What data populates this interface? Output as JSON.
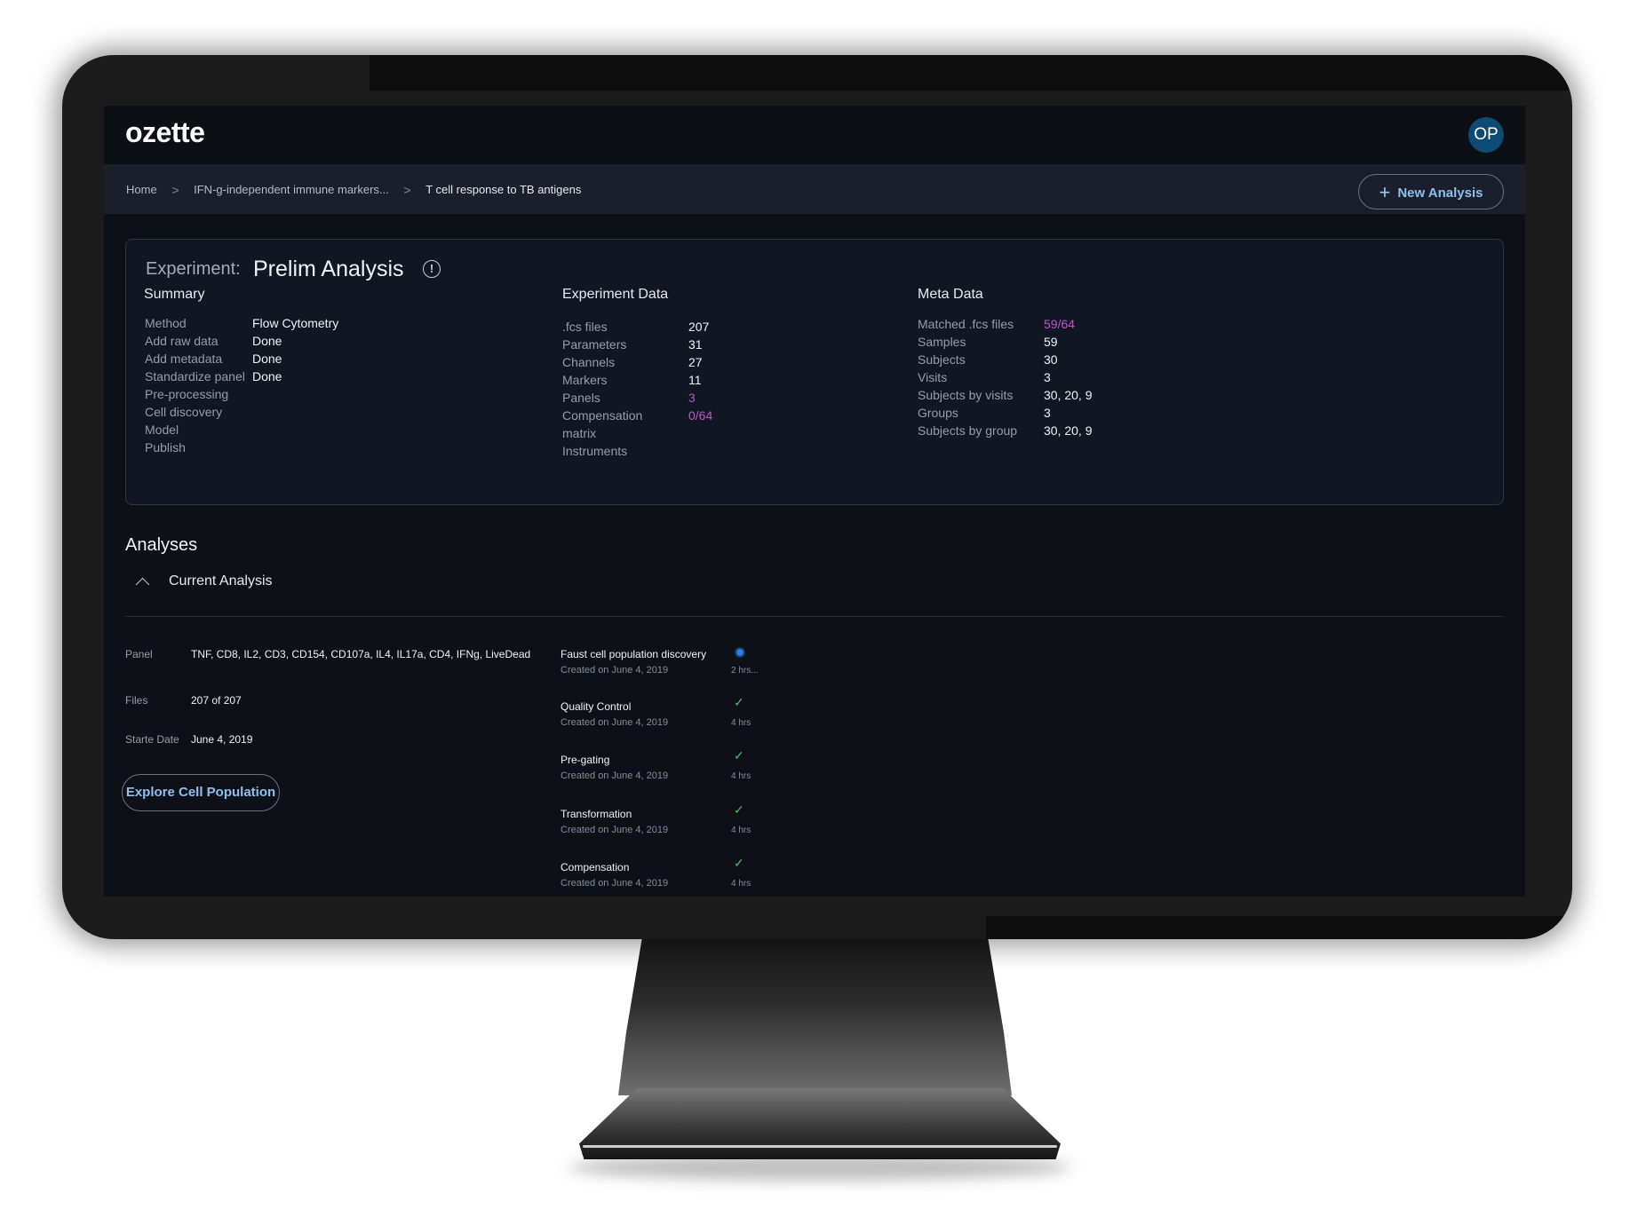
{
  "app": {
    "logo": "ozette",
    "avatar_initials": "OP"
  },
  "breadcrumb": {
    "items": [
      "Home",
      "IFN-g-independent immune markers...",
      "T cell response to TB antigens"
    ],
    "separator": ">"
  },
  "header": {
    "new_analysis_label": "New Analysis",
    "plus_icon": "+"
  },
  "experiment": {
    "label": "Experiment:",
    "title": "Prelim Analysis",
    "info_icon": "!",
    "summary": {
      "heading": "Summary",
      "rows": [
        {
          "key": "Method",
          "value": "Flow Cytometry"
        },
        {
          "key": "Add raw data",
          "value": "Done"
        },
        {
          "key": "Add metadata",
          "value": "Done"
        },
        {
          "key": "Standardize panel",
          "value": "Done"
        },
        {
          "key": "Pre-processing",
          "value": ""
        },
        {
          "key": "Cell discovery",
          "value": ""
        },
        {
          "key": "Model",
          "value": ""
        },
        {
          "key": "Publish",
          "value": ""
        }
      ]
    },
    "experiment_data": {
      "heading": "Experiment Data",
      "rows": [
        {
          "key": ".fcs files",
          "value": "207"
        },
        {
          "key": "Parameters",
          "value": "31"
        },
        {
          "key": "Channels",
          "value": "27"
        },
        {
          "key": "Markers",
          "value": "11"
        },
        {
          "key": "Panels",
          "value": "3"
        },
        {
          "key": "Compensation",
          "value": "0/64"
        },
        {
          "key": "matrix",
          "value": ""
        },
        {
          "key": "Instruments",
          "value": ""
        }
      ]
    },
    "meta_data": {
      "heading": "Meta Data",
      "rows": [
        {
          "key": "Matched .fcs files",
          "value": "59/64"
        },
        {
          "key": "Samples",
          "value": "59"
        },
        {
          "key": "Subjects",
          "value": "30"
        },
        {
          "key": "Visits",
          "value": "3"
        },
        {
          "key": "Subjects by visits",
          "value": "30, 20, 9"
        },
        {
          "key": "Groups",
          "value": "3"
        },
        {
          "key": "Subjects by group",
          "value": "30, 20, 9"
        }
      ]
    }
  },
  "analyses": {
    "heading": "Analyses",
    "current_heading": "Current Analysis",
    "panel_label": "Panel",
    "panel_value": "TNF, CD8, IL2, CD3, CD154, CD107a, IL4, IL17a, CD4, IFNg, LiveDead",
    "files_label": "Files",
    "files_value": "207 of 207",
    "start_label": "Starte Date",
    "start_value": "June 4, 2019",
    "explore_label": "Explore Cell Population",
    "steps": [
      {
        "name": "Faust cell population discovery",
        "created": "Created on June 4, 2019",
        "duration": "2 hrs...",
        "status": "running"
      },
      {
        "name": "Quality Control",
        "created": "Created on June 4, 2019",
        "duration": "4 hrs",
        "status": "done"
      },
      {
        "name": "Pre-gating",
        "created": "Created on June 4, 2019",
        "duration": "4 hrs",
        "status": "done"
      },
      {
        "name": "Transformation",
        "created": "Created on June 4, 2019",
        "duration": "4 hrs",
        "status": "done"
      },
      {
        "name": "Compensation",
        "created": "Created on June 4, 2019",
        "duration": "4 hrs",
        "status": "done"
      }
    ],
    "check_glyph": "✓"
  },
  "colors": {
    "background": "#0d1117",
    "accent": "#8cc0ef",
    "highlight": "#c055c9",
    "success": "#4dbb6a",
    "running": "#2a7de1"
  }
}
